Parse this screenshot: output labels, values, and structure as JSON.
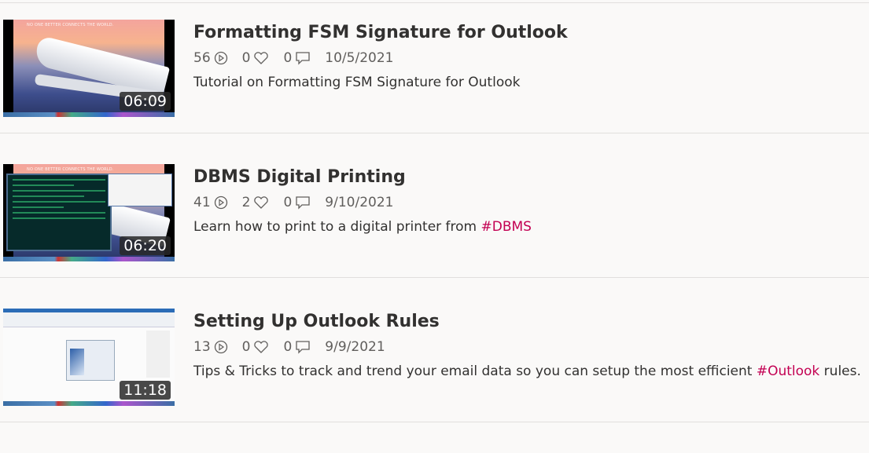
{
  "accent_color": "#c30052",
  "videos": [
    {
      "title": "Formatting FSM Signature for Outlook",
      "duration": "06:09",
      "views": "56",
      "likes": "0",
      "comments": "0",
      "date": "10/5/2021",
      "description": "Tutorial on Formatting FSM Signature for Outlook",
      "description_tag": "",
      "description_after": "",
      "thumbnail_text": "NO ONE BETTER CONNECTS THE WORLD."
    },
    {
      "title": "DBMS Digital Printing",
      "duration": "06:20",
      "views": "41",
      "likes": "2",
      "comments": "0",
      "date": "9/10/2021",
      "description": "Learn how to print to a digital printer from ",
      "description_tag": "#DBMS",
      "description_after": "",
      "thumbnail_text": "NO ONE BETTER CONNECTS THE WORLD."
    },
    {
      "title": "Setting Up Outlook Rules",
      "duration": "11:18",
      "views": "13",
      "likes": "0",
      "comments": "0",
      "date": "9/9/2021",
      "description": "Tips & Tricks to track and trend your email data so you can setup the most efficient ",
      "description_tag": "#Outlook",
      "description_after": " rules."
    }
  ],
  "icons": {
    "views": "play-circle-icon",
    "likes": "heart-icon",
    "comments": "comment-icon"
  }
}
